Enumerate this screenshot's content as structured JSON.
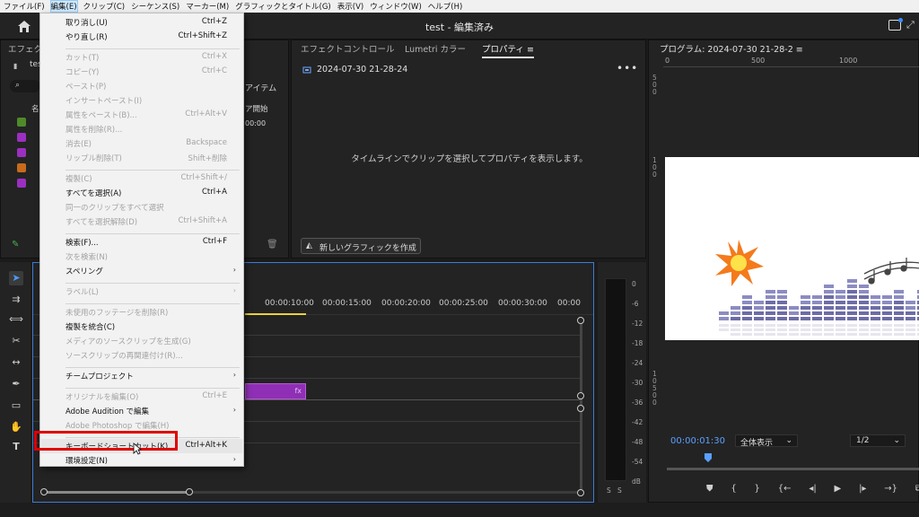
{
  "menubar": {
    "items": [
      "ファイル(F)",
      "編集(E)",
      "クリップ(C)",
      "シーケンス(S)",
      "マーカー(M)",
      "グラフィックとタイトル(G)",
      "表示(V)",
      "ウィンドウ(W)",
      "ヘルプ(H)"
    ],
    "open_index": 1
  },
  "titlebar": {
    "title": "test - 編集済み"
  },
  "project_panel": {
    "tab": "エフェク",
    "item_frag": "tes",
    "col_frag": "名",
    "item_frag2": "アイテム",
    "col_frag2": "ア開始",
    "time_frag": "00:00",
    "chip_colors": [
      "#4f8a2a",
      "#9b30c0",
      "#9b30c0",
      "#c86a1c",
      "#9b30c0"
    ]
  },
  "effect_panel": {
    "tabs": [
      "エフェクトコントロール",
      "Lumetri カラー",
      "プロパティ"
    ],
    "active_tab": "プロパティ",
    "sequence_name": "2024-07-30 21-28-24",
    "more": "•••",
    "message": "タイムラインでクリップを選択してプロパティを表示します。",
    "new_graphic_button": "新しいグラフィックを作成"
  },
  "program_monitor": {
    "title": "プログラム: 2024-07-30 21-28-2",
    "ruler_labels": [
      "0",
      "500",
      "1000"
    ],
    "vruler_labels": [
      "5",
      "0",
      "0",
      "1",
      "0",
      "0",
      "1",
      "0",
      "5",
      "0",
      "0"
    ],
    "timecode": "00:00:01:30",
    "zoom": "全体表示",
    "resolution": "1/2",
    "transport": [
      "marker",
      "in",
      "out",
      "go-in",
      "step-back",
      "play",
      "step-fwd",
      "go-out",
      "insert"
    ]
  },
  "timeline": {
    "timecodes": [
      "00:00:10:00",
      "00:00:15:00",
      "00:00:20:00",
      "00:00:25:00",
      "00:00:30:00",
      "00:00"
    ],
    "clip_label": "fx"
  },
  "meter": {
    "labels": [
      "0",
      "-6",
      "-12",
      "-18",
      "-24",
      "-30",
      "-36",
      "-42",
      "-48",
      "-54",
      "dB"
    ],
    "solo": [
      "S",
      "S"
    ]
  },
  "edit_menu": {
    "items": [
      {
        "label": "取り消し(U)",
        "shortcut": "Ctrl+Z",
        "enabled": true
      },
      {
        "label": "やり直し(R)",
        "shortcut": "Ctrl+Shift+Z",
        "enabled": true
      },
      {
        "sep": true
      },
      {
        "label": "カット(T)",
        "shortcut": "Ctrl+X",
        "enabled": false
      },
      {
        "label": "コピー(Y)",
        "shortcut": "Ctrl+C",
        "enabled": false
      },
      {
        "label": "ペースト(P)",
        "shortcut": "",
        "enabled": false
      },
      {
        "label": "インサートペースト(I)",
        "shortcut": "",
        "enabled": false
      },
      {
        "label": "属性をペースト(B)...",
        "shortcut": "Ctrl+Alt+V",
        "enabled": false
      },
      {
        "label": "属性を削除(R)...",
        "shortcut": "",
        "enabled": false
      },
      {
        "label": "消去(E)",
        "shortcut": "Backspace",
        "enabled": false
      },
      {
        "label": "リップル削除(T)",
        "shortcut": "Shift+削除",
        "enabled": false
      },
      {
        "sep": true
      },
      {
        "label": "複製(C)",
        "shortcut": "Ctrl+Shift+/",
        "enabled": false
      },
      {
        "label": "すべてを選択(A)",
        "shortcut": "Ctrl+A",
        "enabled": true
      },
      {
        "label": "同一のクリップをすべて選択",
        "shortcut": "",
        "enabled": false
      },
      {
        "label": "すべてを選択解除(D)",
        "shortcut": "Ctrl+Shift+A",
        "enabled": false
      },
      {
        "sep": true
      },
      {
        "label": "検索(F)...",
        "shortcut": "Ctrl+F",
        "enabled": true
      },
      {
        "label": "次を検索(N)",
        "shortcut": "",
        "enabled": false
      },
      {
        "label": "スペリング",
        "shortcut": "",
        "enabled": true,
        "submenu": true
      },
      {
        "sep": true
      },
      {
        "label": "ラベル(L)",
        "shortcut": "",
        "enabled": false,
        "submenu": true
      },
      {
        "sep": true
      },
      {
        "label": "未使用のフッテージを削除(R)",
        "shortcut": "",
        "enabled": false
      },
      {
        "label": "複製を統合(C)",
        "shortcut": "",
        "enabled": true
      },
      {
        "label": "メディアのソースクリップを生成(G)",
        "shortcut": "",
        "enabled": false
      },
      {
        "label": "ソースクリップの再関連付け(R)...",
        "shortcut": "",
        "enabled": false
      },
      {
        "sep": true
      },
      {
        "label": "チームプロジェクト",
        "shortcut": "",
        "enabled": true,
        "submenu": true
      },
      {
        "sep": true
      },
      {
        "label": "オリジナルを編集(O)",
        "shortcut": "Ctrl+E",
        "enabled": false
      },
      {
        "label": "Adobe Audition で編集",
        "shortcut": "",
        "enabled": true,
        "submenu": true
      },
      {
        "label": "Adobe Photoshop で編集(H)",
        "shortcut": "",
        "enabled": false
      },
      {
        "sep": true
      },
      {
        "label": "キーボードショートカット(K)...",
        "shortcut": "Ctrl+Alt+K",
        "enabled": true,
        "highlighted": true
      },
      {
        "label": "環境設定(N)",
        "shortcut": "",
        "enabled": true,
        "submenu": true
      }
    ]
  },
  "colors": {
    "accent": "#3d7bd8",
    "highlight": "#e00000",
    "clip": "#8f2fb5",
    "timecode": "#5aa0ff"
  }
}
